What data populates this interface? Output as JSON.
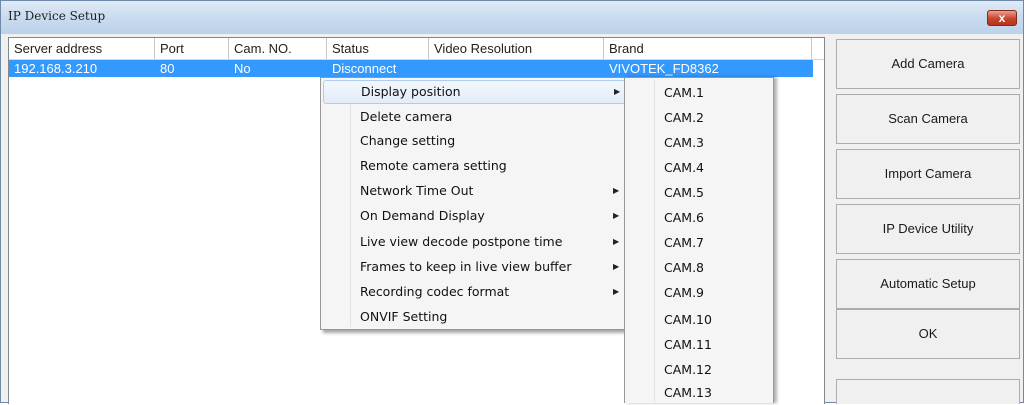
{
  "window": {
    "title": "IP Device Setup",
    "close_label": "x"
  },
  "table": {
    "columns": [
      "Server address",
      "Port",
      "Cam. NO.",
      "Status",
      "Video Resolution",
      "Brand"
    ],
    "rows": [
      [
        "192.168.3.210",
        "80",
        "No",
        "Disconnect",
        "",
        "VIVOTEK_FD8362"
      ]
    ]
  },
  "buttons": {
    "add_camera": "Add Camera",
    "scan_camera": "Scan Camera",
    "import_camera": "Import Camera",
    "ip_device_utility": "IP Device Utility",
    "automatic_setup": "Automatic Setup",
    "ok": "OK"
  },
  "context_menu": {
    "items": [
      {
        "label": "Display position",
        "submenu": true,
        "highlighted": true
      },
      {
        "label": "Delete camera",
        "submenu": false
      },
      {
        "label": "Change setting",
        "submenu": false
      },
      {
        "label": "Remote camera setting",
        "submenu": false
      },
      {
        "label": "Network Time Out",
        "submenu": true
      },
      {
        "label": "On Demand Display",
        "submenu": true
      },
      {
        "label": "Live view decode postpone time",
        "submenu": true
      },
      {
        "label": "Frames to keep in live view buffer",
        "submenu": true
      },
      {
        "label": "Recording codec format",
        "submenu": true
      },
      {
        "label": "ONVIF Setting",
        "submenu": false
      }
    ],
    "submenu_arrow": "▶"
  },
  "sub_menu": {
    "items": [
      "CAM.1",
      "CAM.2",
      "CAM.3",
      "CAM.4",
      "CAM.5",
      "CAM.6",
      "CAM.7",
      "CAM.8",
      "CAM.9",
      "CAM.10",
      "CAM.11",
      "CAM.12",
      "CAM.13"
    ]
  },
  "colors": {
    "selection": "#3399ff",
    "menu_highlight": "#e3ecf9"
  }
}
